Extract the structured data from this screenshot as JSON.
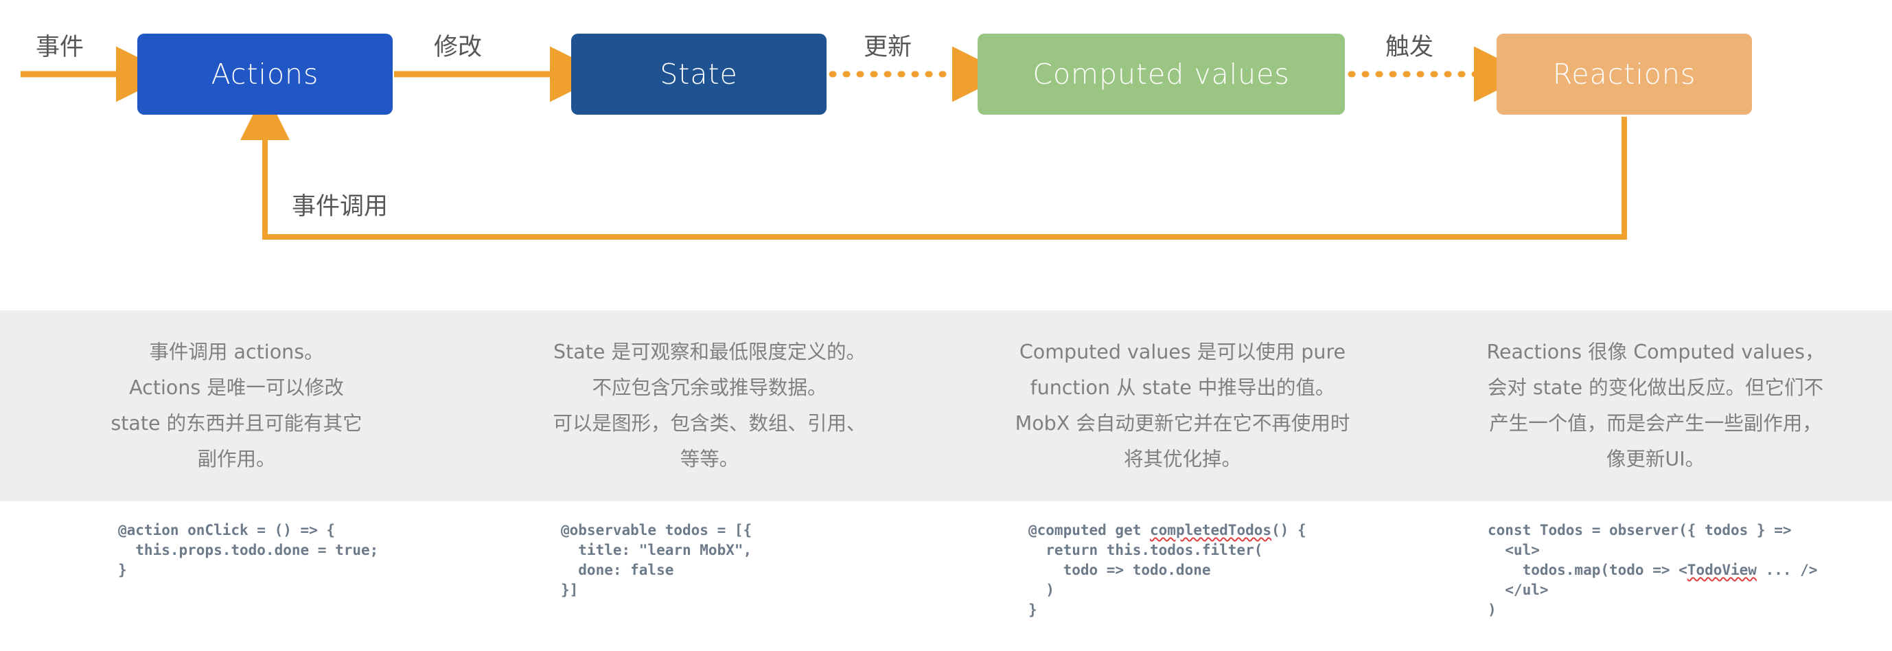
{
  "diagram": {
    "nodes": [
      {
        "id": "actions",
        "label": "Actions",
        "color": "#2156c5"
      },
      {
        "id": "state",
        "label": "State",
        "color": "#1f5291"
      },
      {
        "id": "computed",
        "label": "Computed values",
        "color": "#9bc583"
      },
      {
        "id": "reactions",
        "label": "Reactions",
        "color": "#efb275"
      }
    ],
    "edges": [
      {
        "id": "event",
        "label": "事件",
        "style": "solid"
      },
      {
        "id": "modify",
        "label": "修改",
        "style": "solid"
      },
      {
        "id": "update",
        "label": "更新",
        "style": "dotted"
      },
      {
        "id": "trigger",
        "label": "触发",
        "style": "dotted"
      },
      {
        "id": "loop",
        "label": "事件调用",
        "style": "solid"
      }
    ],
    "arrow_color": "#f0a02e",
    "label_color": "#575757"
  },
  "descriptions": [
    {
      "id": "actions-desc",
      "lines": [
        "事件调用 actions。",
        "Actions 是唯一可以修改",
        "state 的东西并且可能有其它",
        "副作用。"
      ]
    },
    {
      "id": "state-desc",
      "lines": [
        "State 是可观察和最低限度定义的。",
        "不应包含冗余或推导数据。",
        "可以是图形，包含类、数组、引用、",
        "等等。"
      ]
    },
    {
      "id": "computed-desc",
      "lines": [
        "Computed values 是可以使用 pure",
        "function 从 state 中推导出的值。",
        "MobX 会自动更新它并在它不再使用时",
        "将其优化掉。"
      ]
    },
    {
      "id": "reactions-desc",
      "lines": [
        "Reactions 很像 Computed values，",
        "会对 state 的变化做出反应。但它们不",
        "产生一个值，而是会产生一些副作用，",
        "像更新UI。"
      ]
    }
  ],
  "code_samples": [
    {
      "id": "actions-code",
      "text": "@action onClick = () => {\n  this.props.todo.done = true;\n}"
    },
    {
      "id": "state-code",
      "text": "@observable todos = [{\n  title: \"learn MobX\",\n  done: false\n}]"
    },
    {
      "id": "computed-code",
      "text": "@computed get completedTodos() {\n  return this.todos.filter(\n    todo => todo.done\n  )\n}",
      "misspelled": "completedTodos"
    },
    {
      "id": "reactions-code",
      "text": "const Todos = observer({ todos } =>\n  <ul>\n    todos.map(todo => <TodoView ... />\n  </ul>\n)",
      "misspelled": "TodoView"
    }
  ],
  "colors": {
    "band_background": "#eeeeee",
    "page_background": "#ffffff",
    "code_text": "#6c7a89",
    "desc_text": "#808080",
    "squiggle": "#e03e3e"
  }
}
